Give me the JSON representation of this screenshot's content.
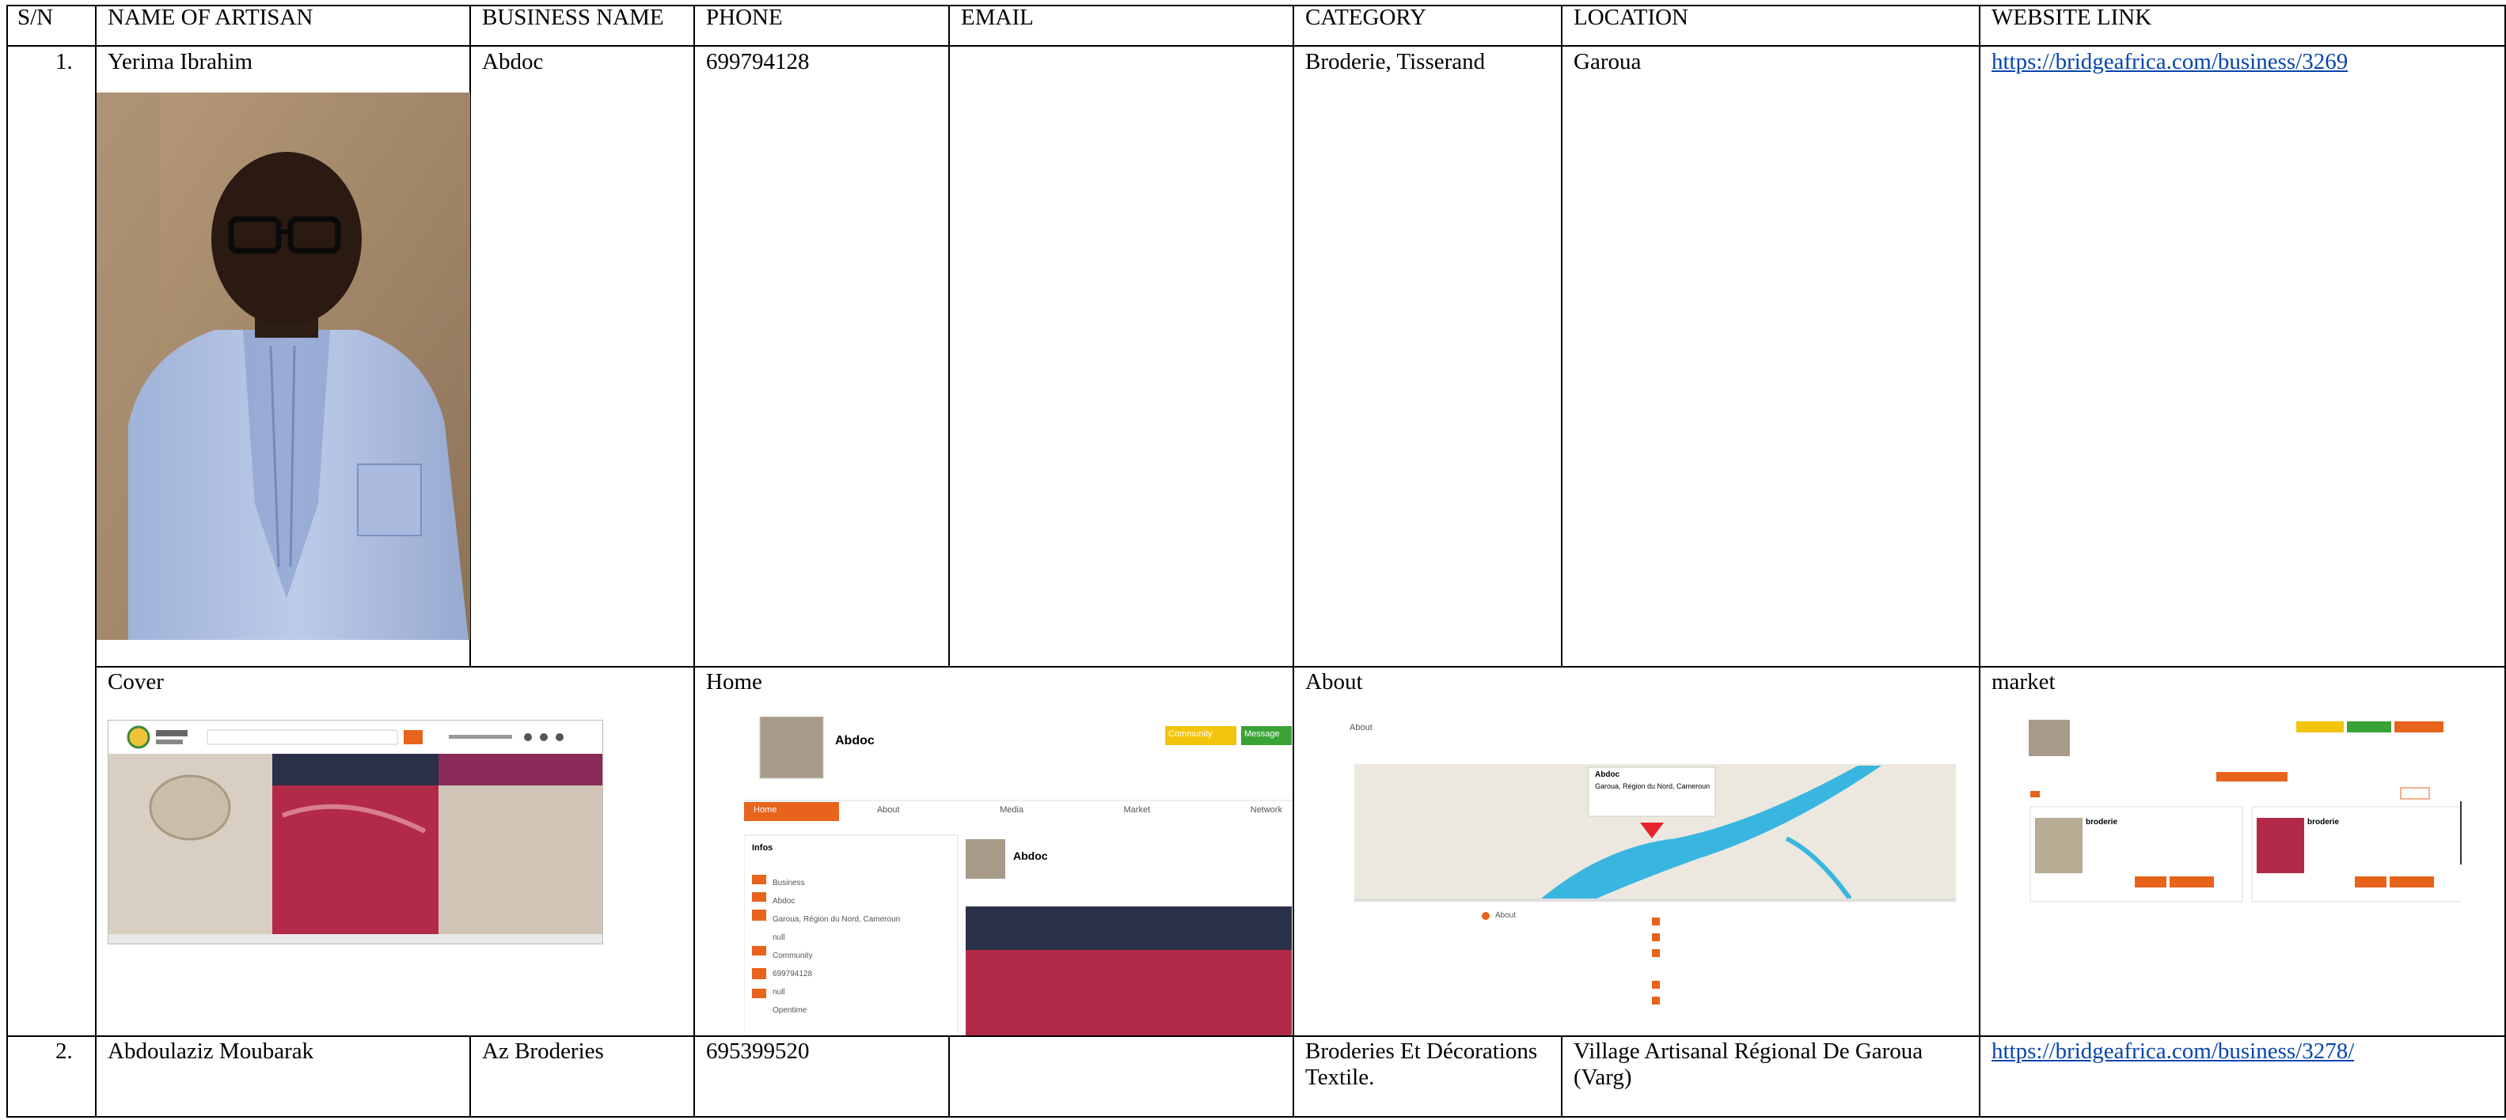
{
  "headers": {
    "sn": "S/N",
    "name": "NAME OF ARTISAN",
    "business": "BUSINESS NAME",
    "phone": "PHONE",
    "email": "EMAIL",
    "category": "CATEGORY",
    "location": "LOCATION",
    "website": "WEBSITE LINK"
  },
  "rows": [
    {
      "sn": "1.",
      "name": "Yerima Ibrahim",
      "business": "Abdoc",
      "phone": "699794128",
      "email": "",
      "category": "Broderie, Tisserand",
      "location": "Garoua",
      "website": "https://bridgeafrica.com/business/3269"
    },
    {
      "sn": "2.",
      "name": "Abdoulaziz Moubarak",
      "business": "Az Broderies",
      "phone": "695399520",
      "email": "",
      "category_line1": "Broderies Et Décorations",
      "category_line2": "Textile.",
      "location_line1": "Village Artisanal Régional De Garoua",
      "location_line2": "(Varg)",
      "website": "https://bridgeafrica.com/business/3278/"
    }
  ],
  "screenshots": {
    "cover": "Cover",
    "home": "Home",
    "about": "About",
    "market": "market"
  },
  "home_shot": {
    "business": "Abdoc",
    "info": "Infos",
    "tabs": [
      "Home",
      "About",
      "Media",
      "Market",
      "Network"
    ],
    "details": [
      "Business",
      "Abdoc",
      "Garoua, Région du Nord, Cameroun",
      "null",
      "Community",
      "699794128",
      "null",
      "Opentime"
    ],
    "post_name": "Abdoc",
    "btn_community": "Community",
    "btn_message": "Message"
  },
  "about_shot": {
    "heading": "About",
    "popup_name": "Abdoc",
    "popup_addr": "Garoua, Région du Nord, Cameroun",
    "about_label": "About"
  },
  "market_shot": {
    "product1": "broderie",
    "product2": "broderie"
  },
  "colors": {
    "link": "#0645ad",
    "orange": "#e8631c",
    "yellow": "#f2c40c",
    "green": "#3aa335",
    "map_water": "#38b6e0"
  }
}
